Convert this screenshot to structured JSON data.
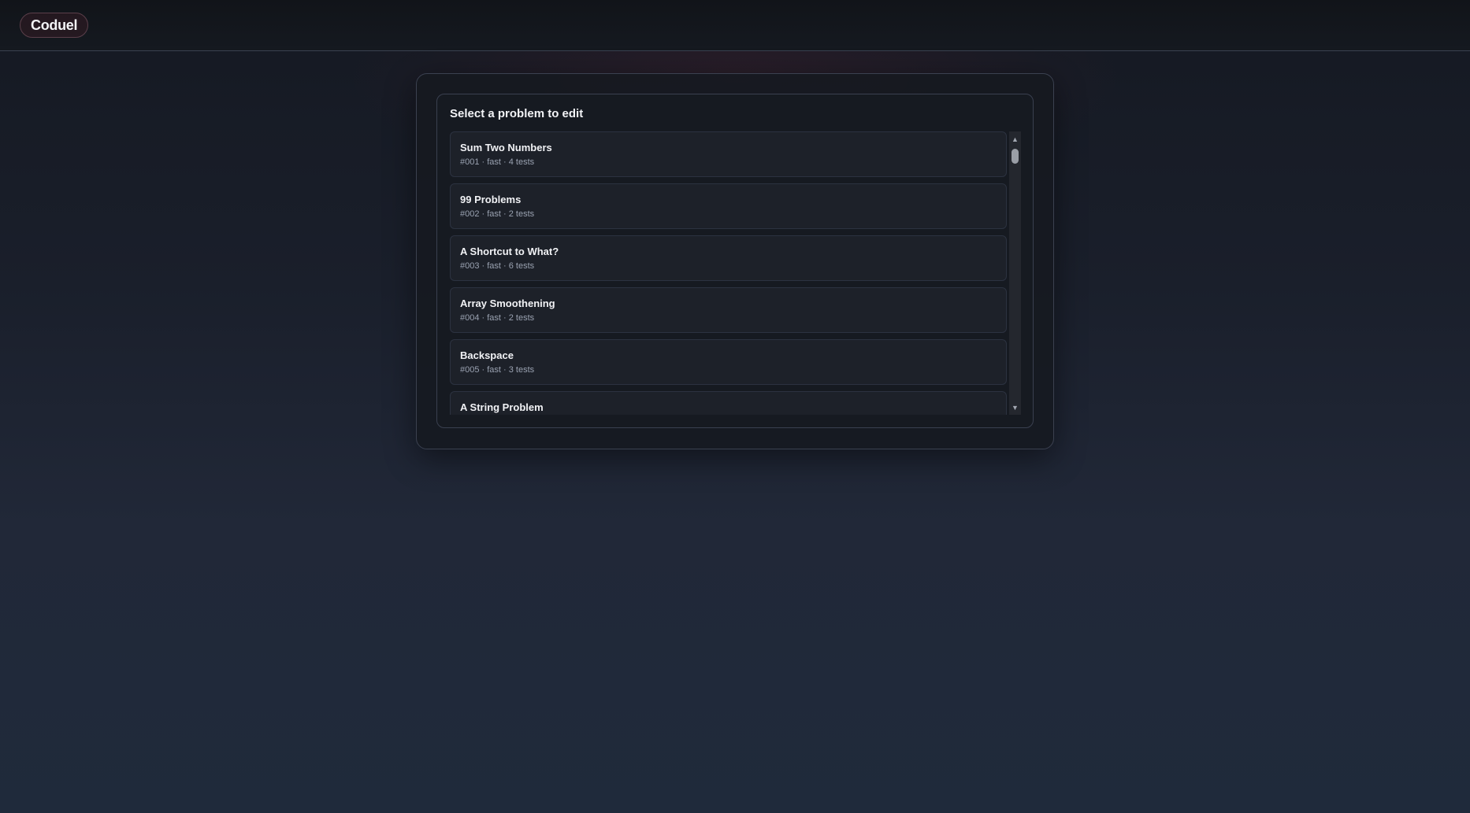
{
  "app": {
    "brand": "Coduel"
  },
  "panel": {
    "title": "Select a problem to edit",
    "problems": [
      {
        "name": "Sum Two Numbers",
        "meta": "#001 · fast · 4 tests"
      },
      {
        "name": "99 Problems",
        "meta": "#002 · fast · 2 tests"
      },
      {
        "name": "A Shortcut to What?",
        "meta": "#003 · fast · 6 tests"
      },
      {
        "name": "Array Smoothening",
        "meta": "#004 · fast · 2 tests"
      },
      {
        "name": "Backspace",
        "meta": "#005 · fast · 3 tests"
      },
      {
        "name": "A String Problem",
        "meta": ""
      }
    ]
  },
  "icons": {
    "scroll_up": "triangle-up-icon",
    "scroll_down": "triangle-down-icon"
  },
  "colors": {
    "accent_border": "#5b3f4a",
    "background": "#1a1f2b"
  }
}
